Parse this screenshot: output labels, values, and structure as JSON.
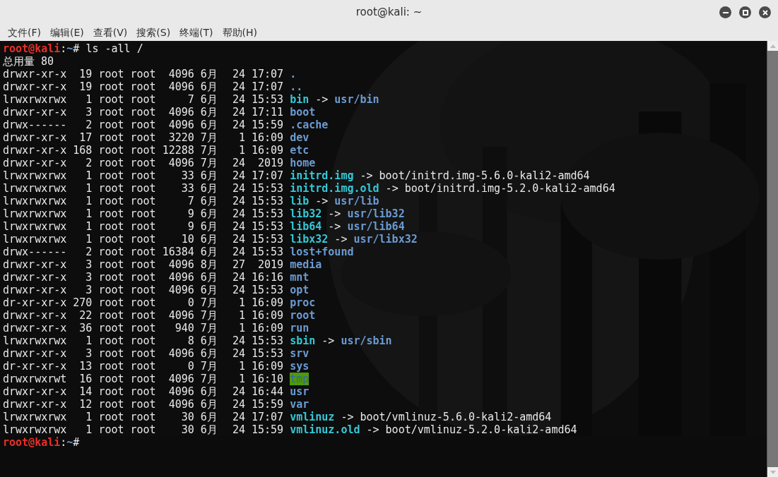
{
  "window": {
    "title": "root@kali: ~"
  },
  "menu": [
    "文件(F)",
    "编辑(E)",
    "查看(V)",
    "搜索(S)",
    "终端(T)",
    "帮助(H)"
  ],
  "terminal": {
    "command_line": {
      "user_host": "root@kali",
      "separator": ":",
      "path": "~",
      "symbol": "#",
      "command": "ls -all /"
    },
    "total": "总用量 80",
    "rows": [
      {
        "perms": "drwxr-xr-x",
        "links": "19",
        "owner": "root",
        "group": "root",
        "size": "4096",
        "month": "6月",
        "day": "24",
        "time": "17:07",
        "name": ".",
        "kind": "dir"
      },
      {
        "perms": "drwxr-xr-x",
        "links": "19",
        "owner": "root",
        "group": "root",
        "size": "4096",
        "month": "6月",
        "day": "24",
        "time": "17:07",
        "name": "..",
        "kind": "dir"
      },
      {
        "perms": "lrwxrwxrwx",
        "links": "1",
        "owner": "root",
        "group": "root",
        "size": "7",
        "month": "6月",
        "day": "24",
        "time": "15:53",
        "name": "bin",
        "kind": "link",
        "arrow": "->",
        "target": "usr/bin",
        "target_is_dir": true
      },
      {
        "perms": "drwxr-xr-x",
        "links": "3",
        "owner": "root",
        "group": "root",
        "size": "4096",
        "month": "6月",
        "day": "24",
        "time": "17:11",
        "name": "boot",
        "kind": "dir"
      },
      {
        "perms": "drwx------",
        "links": "2",
        "owner": "root",
        "group": "root",
        "size": "4096",
        "month": "6月",
        "day": "24",
        "time": "15:59",
        "name": ".cache",
        "kind": "dir"
      },
      {
        "perms": "drwxr-xr-x",
        "links": "17",
        "owner": "root",
        "group": "root",
        "size": "3220",
        "month": "7月",
        "day": "1",
        "time": "16:09",
        "name": "dev",
        "kind": "dir"
      },
      {
        "perms": "drwxr-xr-x",
        "links": "168",
        "owner": "root",
        "group": "root",
        "size": "12288",
        "month": "7月",
        "day": "1",
        "time": "16:09",
        "name": "etc",
        "kind": "dir"
      },
      {
        "perms": "drwxr-xr-x",
        "links": "2",
        "owner": "root",
        "group": "root",
        "size": "4096",
        "month": "7月",
        "day": "24",
        "time": "2019",
        "name": "home",
        "kind": "dir"
      },
      {
        "perms": "lrwxrwxrwx",
        "links": "1",
        "owner": "root",
        "group": "root",
        "size": "33",
        "month": "6月",
        "day": "24",
        "time": "17:07",
        "name": "initrd.img",
        "kind": "link",
        "arrow": "->",
        "target": "boot/initrd.img-5.6.0-kali2-amd64",
        "target_is_dir": false
      },
      {
        "perms": "lrwxrwxrwx",
        "links": "1",
        "owner": "root",
        "group": "root",
        "size": "33",
        "month": "6月",
        "day": "24",
        "time": "15:53",
        "name": "initrd.img.old",
        "kind": "link",
        "arrow": "->",
        "target": "boot/initrd.img-5.2.0-kali2-amd64",
        "target_is_dir": false
      },
      {
        "perms": "lrwxrwxrwx",
        "links": "1",
        "owner": "root",
        "group": "root",
        "size": "7",
        "month": "6月",
        "day": "24",
        "time": "15:53",
        "name": "lib",
        "kind": "link",
        "arrow": "->",
        "target": "usr/lib",
        "target_is_dir": true
      },
      {
        "perms": "lrwxrwxrwx",
        "links": "1",
        "owner": "root",
        "group": "root",
        "size": "9",
        "month": "6月",
        "day": "24",
        "time": "15:53",
        "name": "lib32",
        "kind": "link",
        "arrow": "->",
        "target": "usr/lib32",
        "target_is_dir": true
      },
      {
        "perms": "lrwxrwxrwx",
        "links": "1",
        "owner": "root",
        "group": "root",
        "size": "9",
        "month": "6月",
        "day": "24",
        "time": "15:53",
        "name": "lib64",
        "kind": "link",
        "arrow": "->",
        "target": "usr/lib64",
        "target_is_dir": true
      },
      {
        "perms": "lrwxrwxrwx",
        "links": "1",
        "owner": "root",
        "group": "root",
        "size": "10",
        "month": "6月",
        "day": "24",
        "time": "15:53",
        "name": "libx32",
        "kind": "link",
        "arrow": "->",
        "target": "usr/libx32",
        "target_is_dir": true
      },
      {
        "perms": "drwx------",
        "links": "2",
        "owner": "root",
        "group": "root",
        "size": "16384",
        "month": "6月",
        "day": "24",
        "time": "15:53",
        "name": "lost+found",
        "kind": "dir"
      },
      {
        "perms": "drwxr-xr-x",
        "links": "3",
        "owner": "root",
        "group": "root",
        "size": "4096",
        "month": "8月",
        "day": "27",
        "time": "2019",
        "name": "media",
        "kind": "dir"
      },
      {
        "perms": "drwxr-xr-x",
        "links": "3",
        "owner": "root",
        "group": "root",
        "size": "4096",
        "month": "6月",
        "day": "24",
        "time": "16:16",
        "name": "mnt",
        "kind": "dir"
      },
      {
        "perms": "drwxr-xr-x",
        "links": "3",
        "owner": "root",
        "group": "root",
        "size": "4096",
        "month": "6月",
        "day": "24",
        "time": "15:53",
        "name": "opt",
        "kind": "dir"
      },
      {
        "perms": "dr-xr-xr-x",
        "links": "270",
        "owner": "root",
        "group": "root",
        "size": "0",
        "month": "7月",
        "day": "1",
        "time": "16:09",
        "name": "proc",
        "kind": "dir"
      },
      {
        "perms": "drwxr-xr-x",
        "links": "22",
        "owner": "root",
        "group": "root",
        "size": "4096",
        "month": "7月",
        "day": "1",
        "time": "16:09",
        "name": "root",
        "kind": "dir"
      },
      {
        "perms": "drwxr-xr-x",
        "links": "36",
        "owner": "root",
        "group": "root",
        "size": "940",
        "month": "7月",
        "day": "1",
        "time": "16:09",
        "name": "run",
        "kind": "dir"
      },
      {
        "perms": "lrwxrwxrwx",
        "links": "1",
        "owner": "root",
        "group": "root",
        "size": "8",
        "month": "6月",
        "day": "24",
        "time": "15:53",
        "name": "sbin",
        "kind": "link",
        "arrow": "->",
        "target": "usr/sbin",
        "target_is_dir": true
      },
      {
        "perms": "drwxr-xr-x",
        "links": "3",
        "owner": "root",
        "group": "root",
        "size": "4096",
        "month": "6月",
        "day": "24",
        "time": "15:53",
        "name": "srv",
        "kind": "dir"
      },
      {
        "perms": "dr-xr-xr-x",
        "links": "13",
        "owner": "root",
        "group": "root",
        "size": "0",
        "month": "7月",
        "day": "1",
        "time": "16:09",
        "name": "sys",
        "kind": "dir"
      },
      {
        "perms": "drwxrwxrwt",
        "links": "16",
        "owner": "root",
        "group": "root",
        "size": "4096",
        "month": "7月",
        "day": "1",
        "time": "16:10",
        "name": "tmp",
        "kind": "sticky_dir"
      },
      {
        "perms": "drwxr-xr-x",
        "links": "14",
        "owner": "root",
        "group": "root",
        "size": "4096",
        "month": "6月",
        "day": "24",
        "time": "16:44",
        "name": "usr",
        "kind": "dir"
      },
      {
        "perms": "drwxr-xr-x",
        "links": "12",
        "owner": "root",
        "group": "root",
        "size": "4096",
        "month": "6月",
        "day": "24",
        "time": "15:59",
        "name": "var",
        "kind": "dir"
      },
      {
        "perms": "lrwxrwxrwx",
        "links": "1",
        "owner": "root",
        "group": "root",
        "size": "30",
        "month": "6月",
        "day": "24",
        "time": "17:07",
        "name": "vmlinuz",
        "kind": "link",
        "arrow": "->",
        "target": "boot/vmlinuz-5.6.0-kali2-amd64",
        "target_is_dir": false
      },
      {
        "perms": "lrwxrwxrwx",
        "links": "1",
        "owner": "root",
        "group": "root",
        "size": "30",
        "month": "6月",
        "day": "24",
        "time": "15:59",
        "name": "vmlinuz.old",
        "kind": "link",
        "arrow": "->",
        "target": "boot/vmlinuz-5.2.0-kali2-amd64",
        "target_is_dir": false
      }
    ],
    "final_prompt": {
      "user_host": "root@kali",
      "separator": ":",
      "path": "~",
      "symbol": "#"
    }
  }
}
